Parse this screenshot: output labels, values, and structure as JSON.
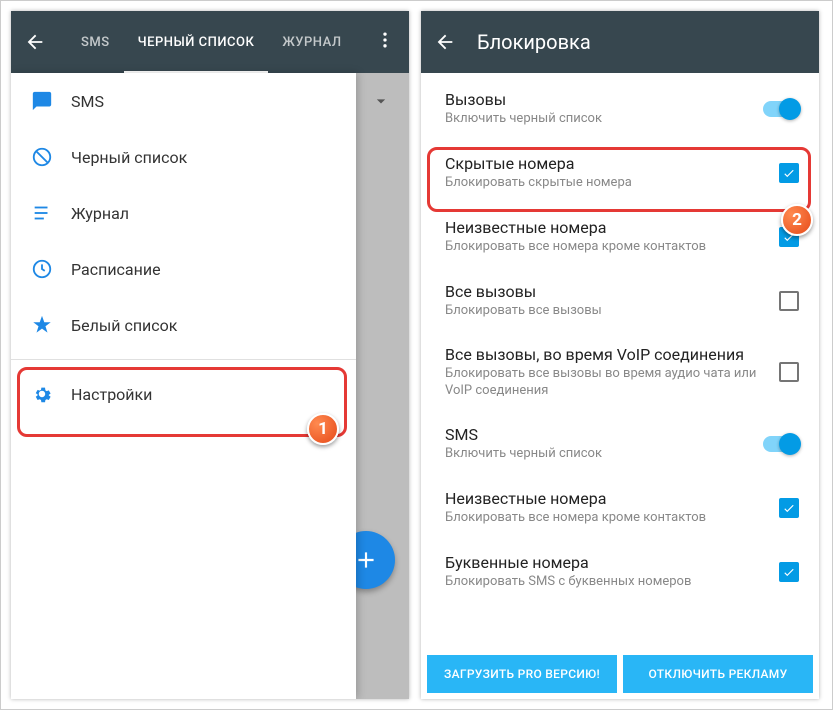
{
  "left": {
    "tabs": [
      "SMS",
      "ЧЕРНЫЙ СПИСОК",
      "ЖУРНАЛ"
    ],
    "active_tab_index": 1,
    "drawer": [
      {
        "icon": "sms-icon",
        "color": "#1E88E5",
        "label": "SMS"
      },
      {
        "icon": "block-icon",
        "color": "#1E88E5",
        "label": "Черный список"
      },
      {
        "icon": "log-icon",
        "color": "#1E88E5",
        "label": "Журнал"
      },
      {
        "icon": "schedule-icon",
        "color": "#1E88E5",
        "label": "Расписание"
      },
      {
        "icon": "star-icon",
        "color": "#1E88E5",
        "label": "Белый список"
      },
      {
        "icon": "gear-icon",
        "color": "#1E88E5",
        "label": "Настройки"
      }
    ],
    "badge": "1"
  },
  "right": {
    "title": "Блокировка",
    "items": [
      {
        "label": "Вызовы",
        "sub": "Включить черный список",
        "control": "switch",
        "checked": true
      },
      {
        "label": "Скрытые номера",
        "sub": "Блокировать скрытые номера",
        "control": "checkbox",
        "checked": true
      },
      {
        "label": "Неизвестные номера",
        "sub": "Блокировать все номера кроме контактов",
        "control": "checkbox",
        "checked": true
      },
      {
        "label": "Все вызовы",
        "sub": "Блокировать все вызовы",
        "control": "checkbox",
        "checked": false
      },
      {
        "label": "Все вызовы, во время VoIP соединения",
        "sub": "Блокировать все вызовы во время аудио чата или VoIP соединения",
        "control": "checkbox",
        "checked": false
      },
      {
        "label": "SMS",
        "sub": "Включить черный список",
        "control": "switch",
        "checked": true
      },
      {
        "label": "Неизвестные номера",
        "sub": "Блокировать все номера кроме контактов",
        "control": "checkbox",
        "checked": true
      },
      {
        "label": "Буквенные номера",
        "sub": "Блокировать SMS с буквенных номеров",
        "control": "checkbox",
        "checked": true
      }
    ],
    "buttons": [
      "ЗАГРУЗИТЬ PRO ВЕРСИЮ!",
      "ОТКЛЮЧИТЬ РЕКЛАМУ"
    ],
    "badge": "2"
  }
}
